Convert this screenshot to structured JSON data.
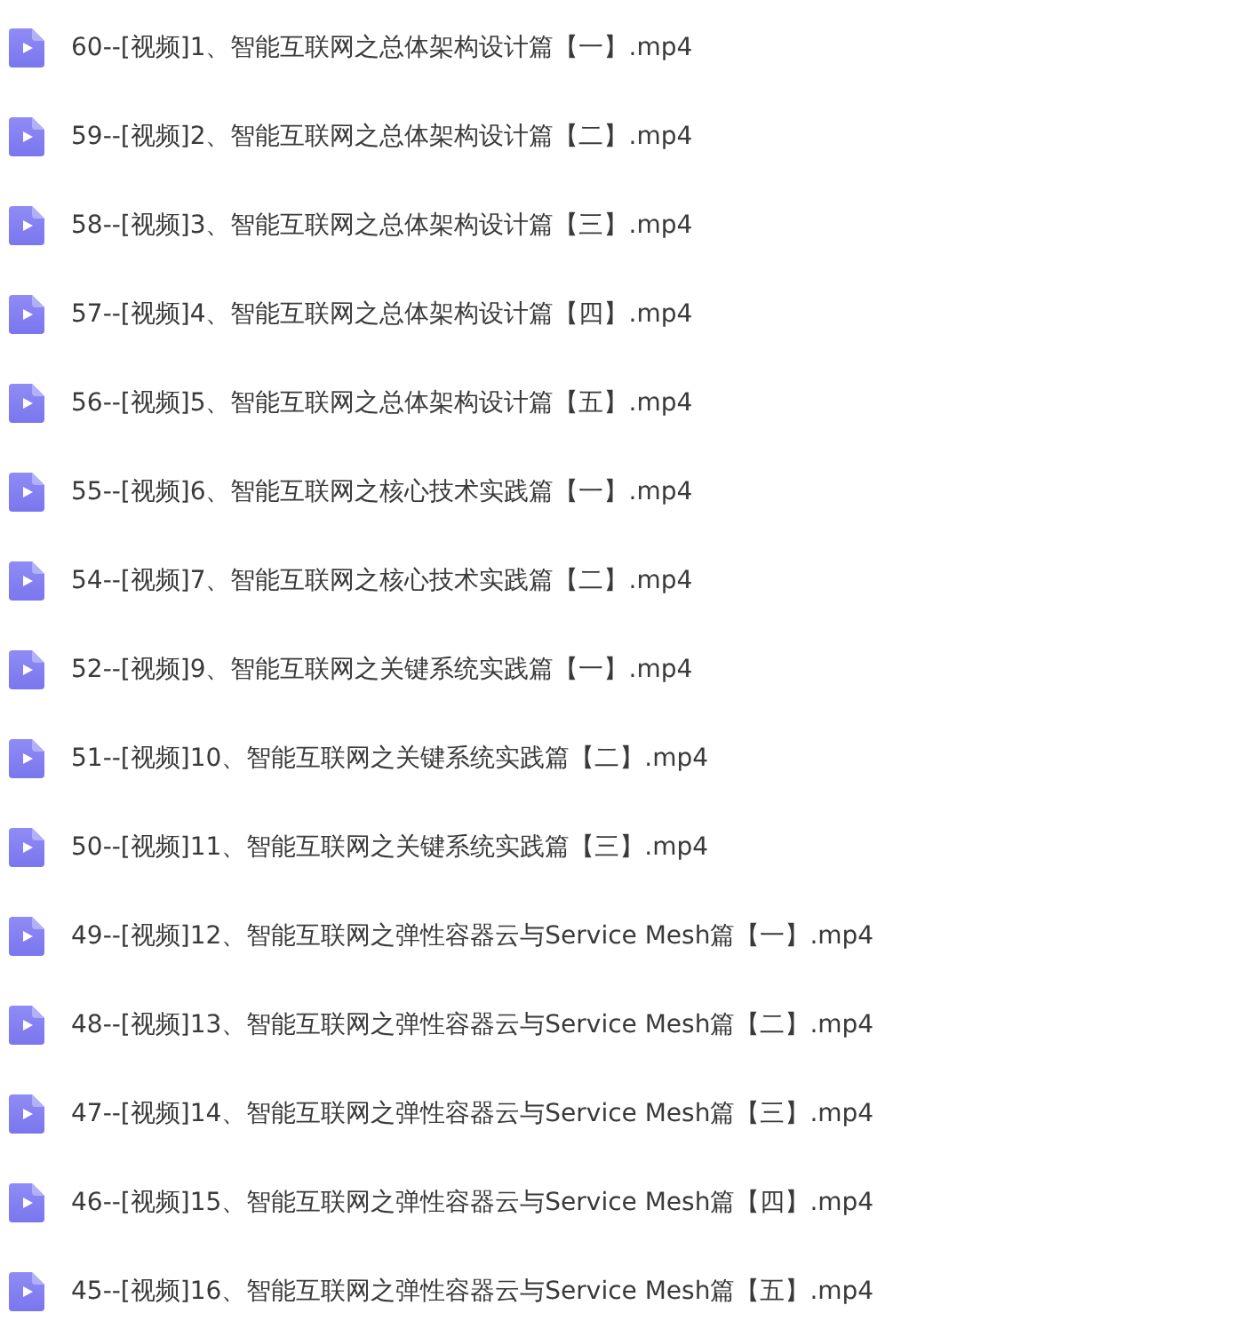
{
  "files": [
    {
      "name": "60--[视频]1、智能互联网之总体架构设计篇【一】.mp4"
    },
    {
      "name": "59--[视频]2、智能互联网之总体架构设计篇【二】.mp4"
    },
    {
      "name": "58--[视频]3、智能互联网之总体架构设计篇【三】.mp4"
    },
    {
      "name": "57--[视频]4、智能互联网之总体架构设计篇【四】.mp4"
    },
    {
      "name": "56--[视频]5、智能互联网之总体架构设计篇【五】.mp4"
    },
    {
      "name": "55--[视频]6、智能互联网之核心技术实践篇【一】.mp4"
    },
    {
      "name": "54--[视频]7、智能互联网之核心技术实践篇【二】.mp4"
    },
    {
      "name": "52--[视频]9、智能互联网之关键系统实践篇【一】.mp4"
    },
    {
      "name": "51--[视频]10、智能互联网之关键系统实践篇【二】.mp4"
    },
    {
      "name": "50--[视频]11、智能互联网之关键系统实践篇【三】.mp4"
    },
    {
      "name": "49--[视频]12、智能互联网之弹性容器云与Service Mesh篇【一】.mp4"
    },
    {
      "name": "48--[视频]13、智能互联网之弹性容器云与Service Mesh篇【二】.mp4"
    },
    {
      "name": "47--[视频]14、智能互联网之弹性容器云与Service Mesh篇【三】.mp4"
    },
    {
      "name": "46--[视频]15、智能互联网之弹性容器云与Service Mesh篇【四】.mp4"
    },
    {
      "name": "45--[视频]16、智能互联网之弹性容器云与Service Mesh篇【五】.mp4"
    }
  ]
}
